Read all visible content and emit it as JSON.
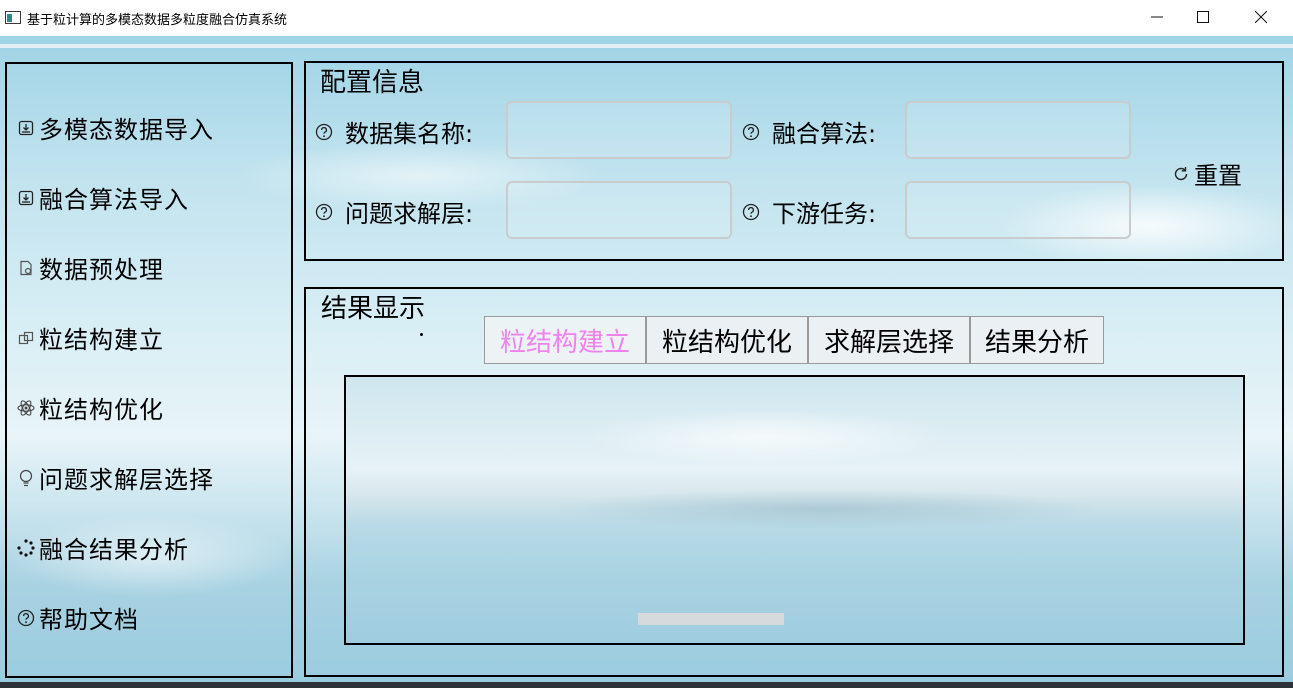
{
  "window": {
    "title": "基于粒计算的多模态数据多粒度融合仿真系统"
  },
  "sidebar": {
    "items": [
      {
        "label": "多模态数据导入",
        "icon": "import-icon"
      },
      {
        "label": "融合算法导入",
        "icon": "import-icon"
      },
      {
        "label": "数据预处理",
        "icon": "file-settings-icon"
      },
      {
        "label": "粒结构建立",
        "icon": "structure-icon"
      },
      {
        "label": "粒结构优化",
        "icon": "atom-icon"
      },
      {
        "label": "问题求解层选择",
        "icon": "bulb-icon"
      },
      {
        "label": "融合结果分析",
        "icon": "loading-icon"
      },
      {
        "label": "帮助文档",
        "icon": "help-icon"
      }
    ]
  },
  "config": {
    "title": "配置信息",
    "fields": {
      "dataset_name": {
        "label": "数据集名称:",
        "value": ""
      },
      "fusion_algorithm": {
        "label": "融合算法:",
        "value": ""
      },
      "problem_layer": {
        "label": "问题求解层:",
        "value": ""
      },
      "downstream_task": {
        "label": "下游任务:",
        "value": ""
      }
    },
    "reset_label": "重置"
  },
  "result": {
    "title": "结果显示",
    "tabs": [
      {
        "label": "粒结构建立",
        "active": true
      },
      {
        "label": "粒结构优化",
        "active": false
      },
      {
        "label": "求解层选择",
        "active": false
      },
      {
        "label": "结果分析",
        "active": false
      }
    ]
  },
  "colors": {
    "active_tab_text": "#ee82ee",
    "panel_border": "#000000",
    "input_border": "#c9cbcc"
  }
}
